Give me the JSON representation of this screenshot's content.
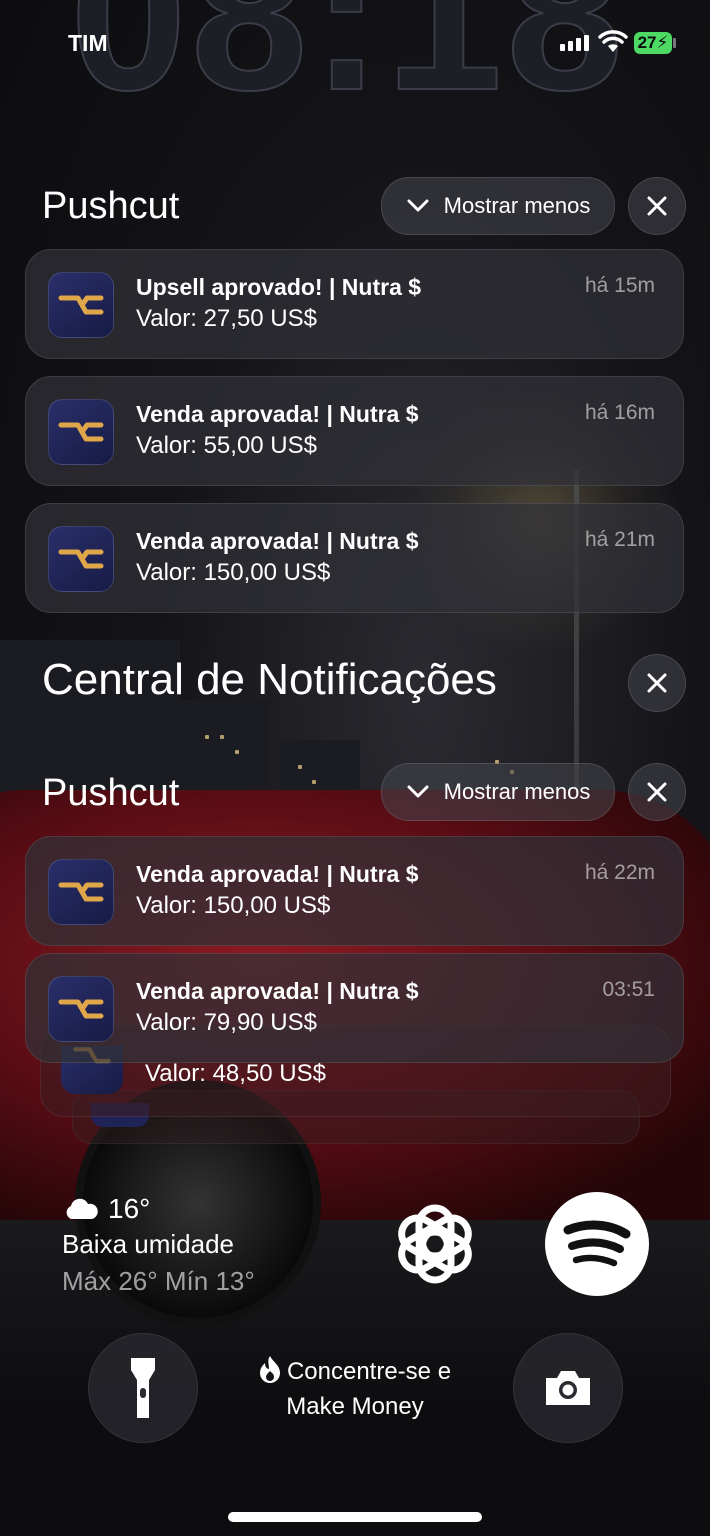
{
  "status_bar": {
    "carrier": "TIM",
    "battery": "27"
  },
  "lock_clock": "08:18",
  "group1": {
    "app": "Pushcut",
    "show_less": "Mostrar menos",
    "notifications": [
      {
        "title": "Upsell aprovado! | Nutra $",
        "body": "Valor: 27,50 US$",
        "time": "há 15m"
      },
      {
        "title": "Venda aprovada! | Nutra $",
        "body": "Valor: 55,00 US$",
        "time": "há 16m"
      },
      {
        "title": "Venda aprovada! | Nutra $",
        "body": "Valor: 150,00 US$",
        "time": "há 21m"
      }
    ]
  },
  "notification_center": {
    "title": "Central de Notificações"
  },
  "group2": {
    "app": "Pushcut",
    "show_less": "Mostrar menos",
    "notifications": [
      {
        "title": "Venda aprovada! | Nutra $",
        "body": "Valor: 150,00 US$",
        "time": "há 22m"
      },
      {
        "title": "Venda aprovada! | Nutra $",
        "body": "Valor: 79,90 US$",
        "time": "03:51"
      }
    ],
    "stacked_body": "Valor: 48,50 US$"
  },
  "weather": {
    "temp": "16°",
    "condition": "Baixa umidade",
    "minmax": "Máx 26° Mín 13°"
  },
  "focus": {
    "line1": "Concentre-se e",
    "line2": "Make Money"
  },
  "colors": {
    "battery": "#4cd964",
    "app_icon": "#1f2355",
    "accent_gold": "#e0a64a"
  }
}
